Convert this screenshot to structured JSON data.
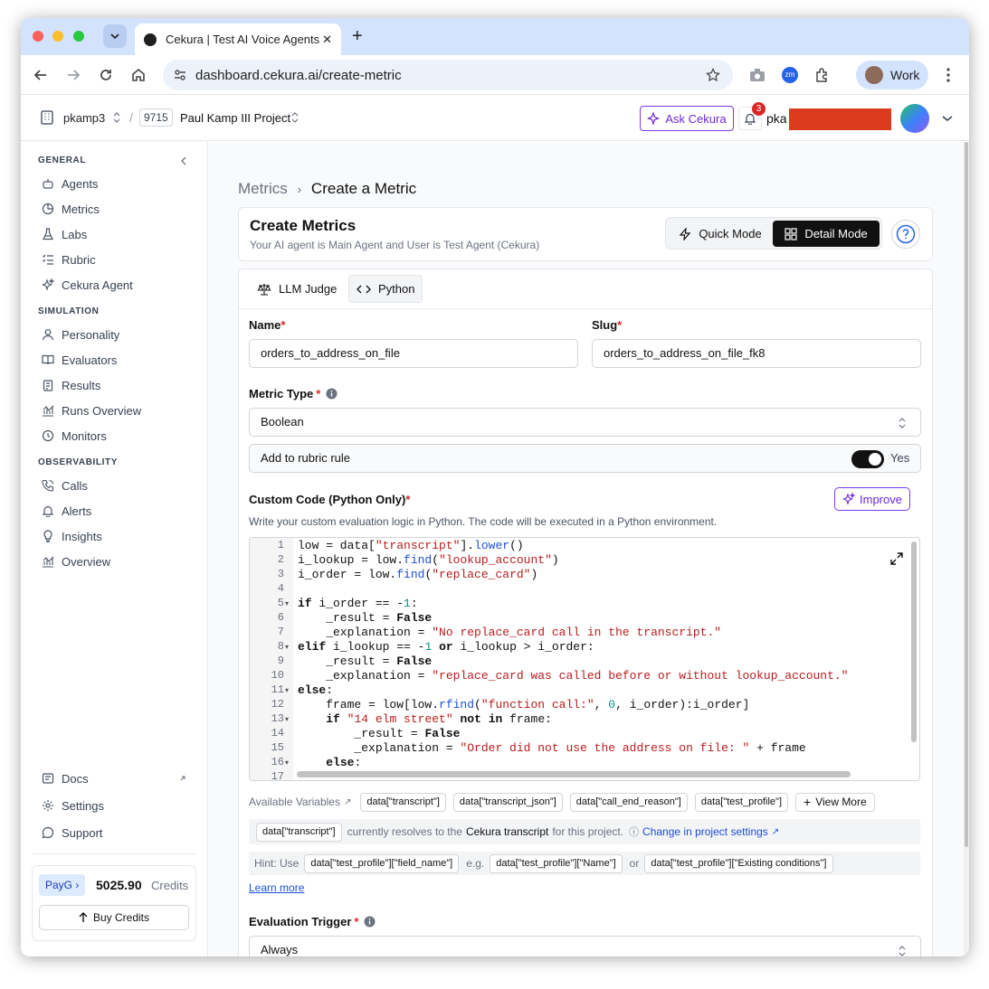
{
  "browser": {
    "tab_title": "Cekura | Test AI Voice Agents",
    "url": "dashboard.cekura.ai/create-metric",
    "profile_name": "Work"
  },
  "header": {
    "org": "pkamp3",
    "project_id": "9715",
    "project_name": "Paul Kamp III Project",
    "ask_label": "Ask Cekura",
    "notification_count": "3",
    "user_name": "pka"
  },
  "sidebar": {
    "general_label": "GENERAL",
    "general_items": [
      {
        "label": "Agents",
        "icon": "agents-icon"
      },
      {
        "label": "Metrics",
        "icon": "metrics-icon"
      },
      {
        "label": "Labs",
        "icon": "flask-icon"
      },
      {
        "label": "Rubric",
        "icon": "list-icon"
      },
      {
        "label": "Cekura Agent",
        "icon": "sparkle-icon"
      }
    ],
    "simulation_label": "SIMULATION",
    "simulation_items": [
      {
        "label": "Personality",
        "icon": "user-icon"
      },
      {
        "label": "Evaluators",
        "icon": "book-icon"
      },
      {
        "label": "Results",
        "icon": "clipboard-icon"
      },
      {
        "label": "Runs Overview",
        "icon": "chart-icon"
      },
      {
        "label": "Monitors",
        "icon": "clock-icon"
      }
    ],
    "observability_label": "OBSERVABILITY",
    "observability_items": [
      {
        "label": "Calls",
        "icon": "phone-icon"
      },
      {
        "label": "Alerts",
        "icon": "bell-icon"
      },
      {
        "label": "Insights",
        "icon": "lightbulb-icon"
      },
      {
        "label": "Overview",
        "icon": "chart-icon"
      }
    ],
    "bottom_items": [
      {
        "label": "Docs",
        "icon": "docs-icon"
      },
      {
        "label": "Settings",
        "icon": "gear-icon"
      },
      {
        "label": "Support",
        "icon": "chat-icon"
      }
    ],
    "plan": "PayG",
    "credits_value": "5025.90",
    "credits_label": "Credits",
    "buy_label": "Buy Credits"
  },
  "page": {
    "breadcrumb_parent": "Metrics",
    "breadcrumb_current": "Create a Metric",
    "title": "Create Metrics",
    "subtitle": "Your AI agent is Main Agent and User is Test Agent (Cekura)",
    "quick_mode": "Quick Mode",
    "detail_mode": "Detail Mode",
    "tabs": {
      "llm": "LLM Judge",
      "python": "Python"
    }
  },
  "form": {
    "name_label": "Name",
    "name_value": "orders_to_address_on_file",
    "slug_label": "Slug",
    "slug_value": "orders_to_address_on_file_fk8",
    "metric_type_label": "Metric Type",
    "metric_type_value": "Boolean",
    "rubric_label": "Add to rubric rule",
    "rubric_value": "Yes",
    "custom_code_label": "Custom Code (Python Only)",
    "improve_label": "Improve",
    "custom_code_desc": "Write your custom evaluation logic in Python. The code will be executed in a Python environment.",
    "code_lines": [
      "low = data[\"transcript\"].lower()",
      "i_lookup = low.find(\"lookup_account\")",
      "i_order = low.find(\"replace_card\")",
      "",
      "if i_order == -1:",
      "    _result = False",
      "    _explanation = \"No replace_card call in the transcript.\"",
      "elif i_lookup == -1 or i_lookup > i_order:",
      "    _result = False",
      "    _explanation = \"replace_card was called before or without lookup_account.\"",
      "else:",
      "    frame = low[low.rfind(\"function call:\", 0, i_order):i_order]",
      "    if \"14 elm street\" not in frame:",
      "        _result = False",
      "        _explanation = \"Order did not use the address on file: \" + frame",
      "    else:",
      ""
    ],
    "available_vars_label": "Available Variables",
    "variables": [
      "data[\"transcript\"]",
      "data[\"transcript_json\"]",
      "data[\"call_end_reason\"]",
      "data[\"test_profile\"]"
    ],
    "view_more": "View More",
    "resolve_chip": "data[\"transcript\"]",
    "resolve_text": "currently resolves to the",
    "resolve_target": "Cekura transcript",
    "resolve_suffix": "for this project.",
    "change_link": "Change in project settings",
    "hint_prefix": "Hint: Use",
    "hint_chip1": "data[\"test_profile\"][\"field_name\"]",
    "hint_eg": "e.g.",
    "hint_chip2": "data[\"test_profile\"][\"Name\"]",
    "hint_or": "or",
    "hint_chip3": "data[\"test_profile\"][\"Existing conditions\"]",
    "learn_more": "Learn more",
    "trigger_label": "Evaluation Trigger",
    "trigger_value": "Always"
  },
  "colors": {
    "accent": "#7c3aed",
    "dark": "#111111",
    "link": "#1d4ed8"
  }
}
